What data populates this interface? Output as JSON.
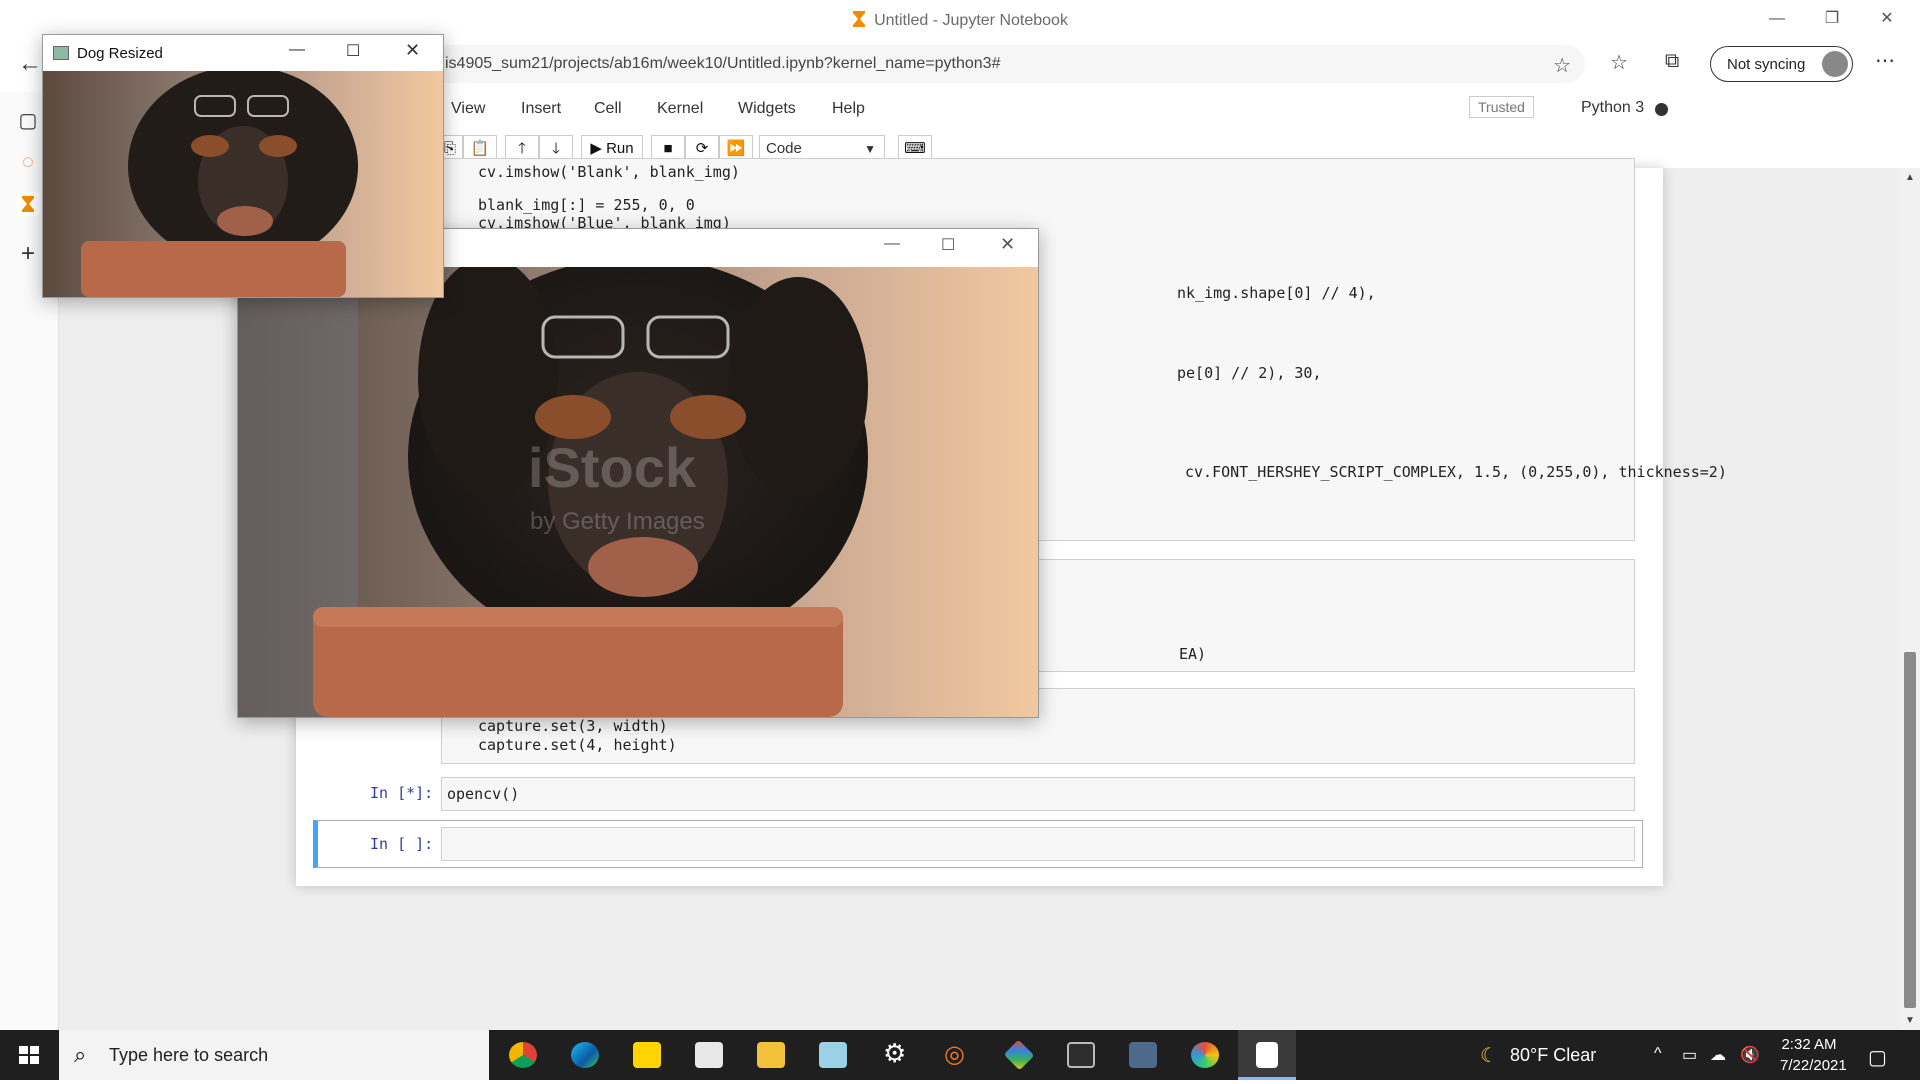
{
  "browser": {
    "title": "Untitled - Jupyter Notebook",
    "url": "is4905_sum21/projects/ab16m/week10/Untitled.ipynb?kernel_name=python3#",
    "sync_label": "Not syncing"
  },
  "jupyter": {
    "menu": [
      "View",
      "Insert",
      "Cell",
      "Kernel",
      "Widgets",
      "Help"
    ],
    "trusted": "Trusted",
    "kernel": "Python 3",
    "run_label": "Run",
    "cell_type": "Code"
  },
  "cells": {
    "top_lines": [
      "cv.imshow('Blank', blank_img)",
      "blank_img[:] = 255, 0, 0",
      "cv.imshow('Blue', blank_img)"
    ],
    "frag1": "nk_img.shape[0] // 4),",
    "frag2": "pe[0] // 2), 30,",
    "frag3": "cv.FONT_HERSHEY_SCRIPT_COMPLEX, 1.5, (0,255,0), thickness=2)",
    "frag4": "EA)",
    "cap1": "capture.set(3, width)",
    "cap2": "capture.set(4, height)",
    "prompt_running": "In [*]:",
    "running_code": "opencv()",
    "prompt_empty": "In [ ]:"
  },
  "windows": {
    "small_title": "Dog Resized",
    "watermark_main": "iStock",
    "watermark_sub": "by Getty Images"
  },
  "taskbar": {
    "search_placeholder": "Type here to search",
    "weather": "80°F  Clear",
    "time": "2:32 AM",
    "date": "7/22/2021"
  }
}
